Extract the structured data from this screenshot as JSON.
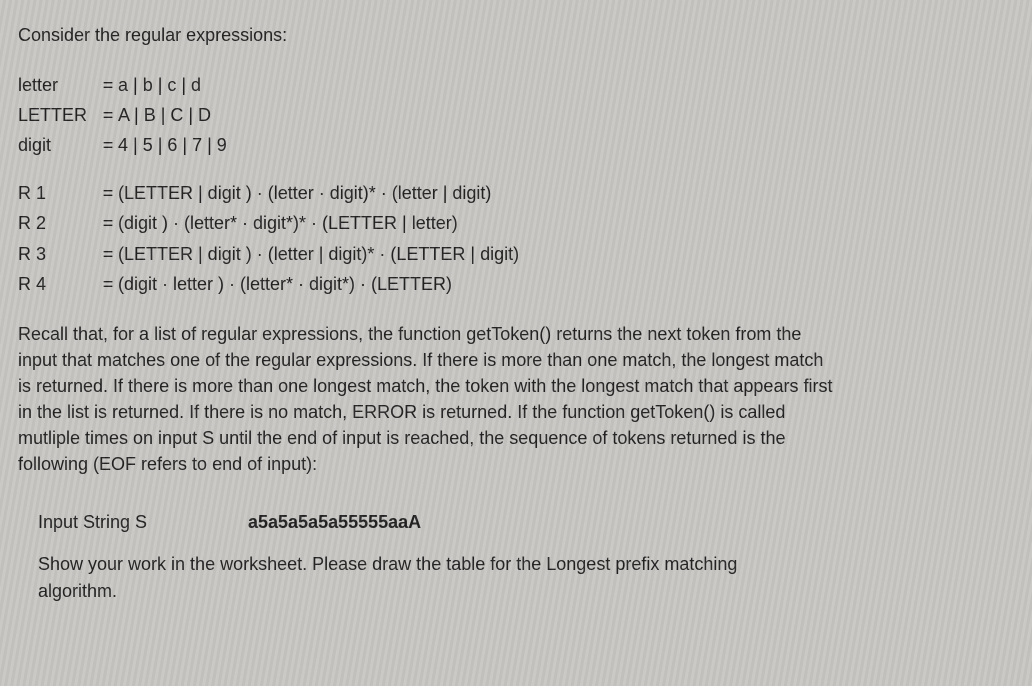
{
  "heading": "Consider the regular expressions:",
  "definitions": [
    {
      "name": "letter",
      "expr": "a | b | c | d"
    },
    {
      "name": "LETTER",
      "expr": "A | B | C | D"
    },
    {
      "name": "digit",
      "expr": "4 | 5 | 6 | 7 | 9"
    }
  ],
  "rules": [
    {
      "name": "R 1",
      "expr": "(LETTER | digit ) · (letter · digit)* · (letter | digit)"
    },
    {
      "name": "R 2",
      "expr": "(digit ) · (letter* · digit*)* · (LETTER | letter)"
    },
    {
      "name": "R 3",
      "expr": "(LETTER | digit ) · (letter | digit)* · (LETTER | digit)"
    },
    {
      "name": "R 4",
      "expr": "(digit · letter ) · (letter* · digit*) · (LETTER)"
    }
  ],
  "explanation": "Recall that, for a list of regular expressions, the function getToken() returns the next token from the input that matches one of the regular expressions. If there is more than one match, the longest match is returned. If there is more than one longest match, the token with the longest match that appears first in the list is returned. If there is no match, ERROR is returned. If the function getToken() is called mutliple times on input S until the end of input is reached, the sequence of tokens returned is the following (EOF refers to end of input):",
  "input": {
    "label": "Input String S",
    "value": "a5a5a5a5a55555aaA"
  },
  "closing": "Show your work in the worksheet. Please draw the table for the Longest prefix matching algorithm."
}
